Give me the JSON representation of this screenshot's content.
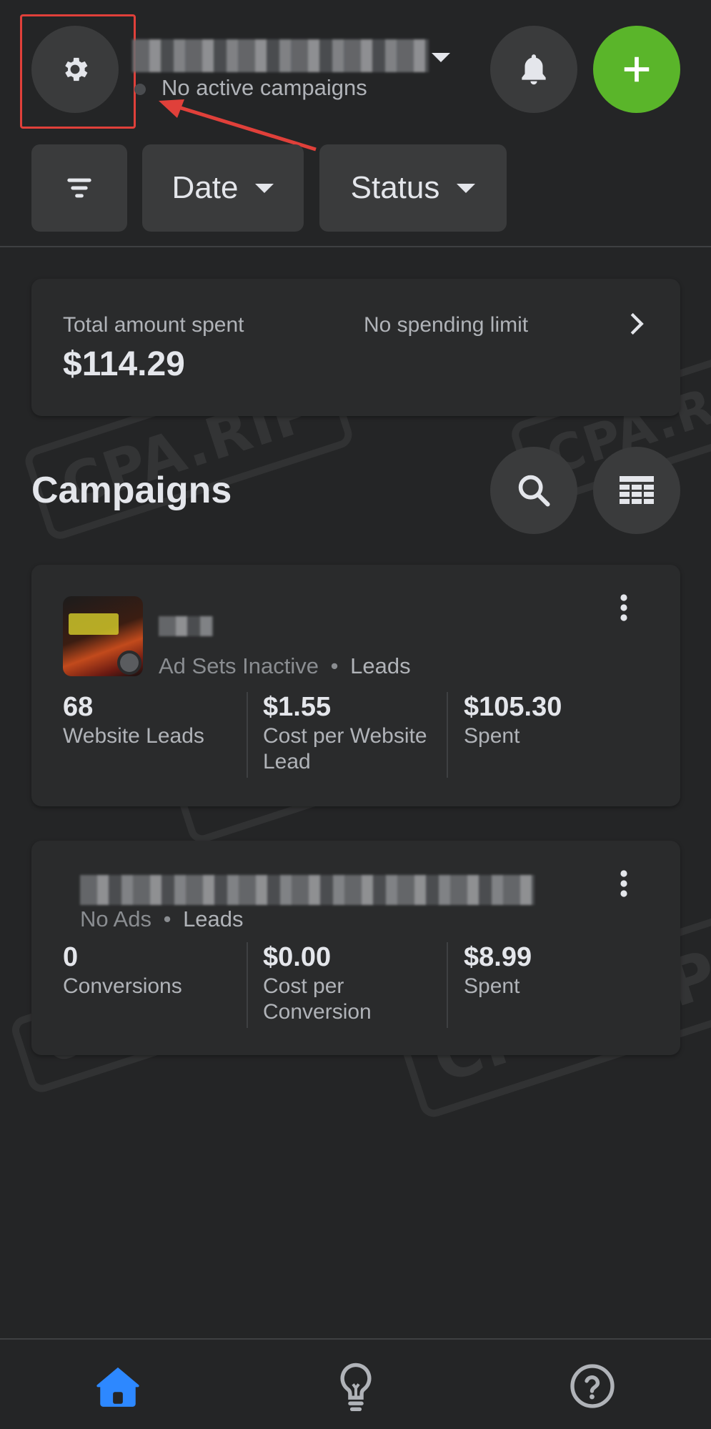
{
  "header": {
    "account_status": "No active campaigns",
    "settings_icon": "gear-icon",
    "notifications_icon": "bell-icon",
    "create_icon": "plus-icon",
    "create_color": "#5ab52a"
  },
  "filters": {
    "filter_icon": "filter-icon",
    "date_label": "Date",
    "status_label": "Status"
  },
  "summary": {
    "total_label": "Total amount spent",
    "total_value": "$114.29",
    "limit_label": "No spending limit"
  },
  "campaigns_section": {
    "title": "Campaigns",
    "search_icon": "search-icon",
    "table_icon": "table-icon"
  },
  "campaigns": [
    {
      "status": "Ad Sets Inactive",
      "objective": "Leads",
      "metrics": [
        {
          "value": "68",
          "label": "Website Leads"
        },
        {
          "value": "$1.55",
          "label": "Cost per Website Lead"
        },
        {
          "value": "$105.30",
          "label": "Spent"
        }
      ]
    },
    {
      "status": "No Ads",
      "objective": "Leads",
      "metrics": [
        {
          "value": "0",
          "label": "Conversions"
        },
        {
          "value": "$0.00",
          "label": "Cost per Conversion"
        },
        {
          "value": "$8.99",
          "label": "Spent"
        }
      ]
    }
  ],
  "bottom_nav": {
    "home_icon": "home-icon",
    "ideas_icon": "lightbulb-icon",
    "help_icon": "help-icon",
    "active_color": "#2d88ff"
  },
  "watermark": "CPA.RIP",
  "highlight_color": "#e0403a"
}
